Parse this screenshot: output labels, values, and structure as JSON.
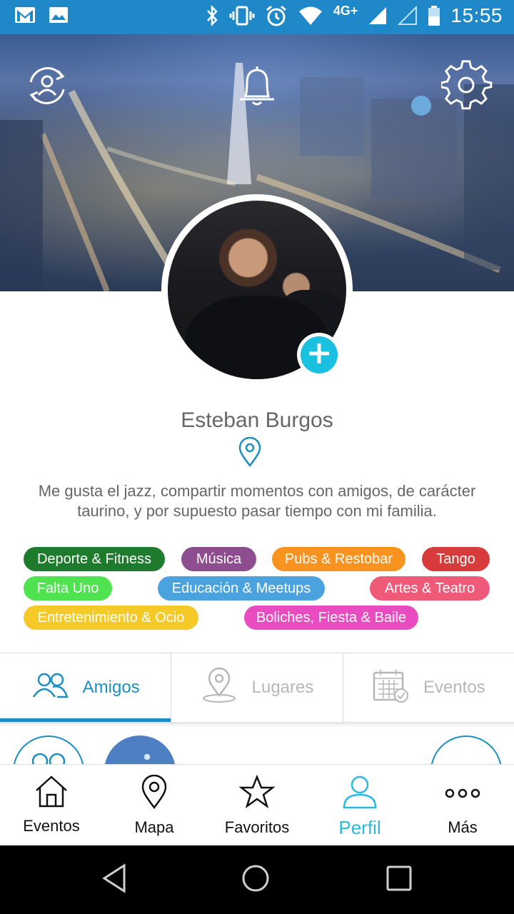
{
  "status_bar": {
    "network": "4G+",
    "time": "15:55",
    "icons": [
      "gmail-icon",
      "image-icon",
      "bluetooth-icon",
      "vibrate-icon",
      "alarm-icon",
      "wifi-icon",
      "signal-icon",
      "signal-icon-2",
      "battery-icon"
    ]
  },
  "header": {
    "icons": [
      "refresh-profile-icon",
      "bell-icon",
      "gear-icon"
    ]
  },
  "profile": {
    "name": "Esteban Burgos",
    "bio": "Me gusta el jazz, compartir momentos con amigos, de carácter taurino, y por supuesto pasar tiempo con mi familia."
  },
  "tags": [
    {
      "label": "Deporte & Fitness",
      "color": "#1e7a2d"
    },
    {
      "label": "Música",
      "color": "#8e4d8e"
    },
    {
      "label": "Pubs & Restobar",
      "color": "#f7931e"
    },
    {
      "label": "Tango",
      "color": "#d83b3b"
    },
    {
      "label": "Falta Uno",
      "color": "#4fe34f"
    },
    {
      "label": "Educación & Meetups",
      "color": "#4aa3df"
    },
    {
      "label": "Artes & Teatro",
      "color": "#ef5a78"
    },
    {
      "label": "Entretenimiento & Ocio",
      "color": "#f4c928"
    },
    {
      "label": "Boliches, Fiesta & Baile",
      "color": "#e94bc0"
    }
  ],
  "tabs": [
    {
      "label": "Amigos",
      "active": true
    },
    {
      "label": "Lugares",
      "active": false
    },
    {
      "label": "Eventos",
      "active": false
    }
  ],
  "bottom_nav": [
    {
      "label": "Eventos"
    },
    {
      "label": "Mapa"
    },
    {
      "label": "Favoritos"
    },
    {
      "label": "Perfil",
      "active": true
    },
    {
      "label": "Más"
    }
  ],
  "colors": {
    "accent": "#1a8fc0",
    "status_bar": "#1e88c9",
    "add_button": "#19c0e0",
    "active_nav": "#29b9e3"
  }
}
